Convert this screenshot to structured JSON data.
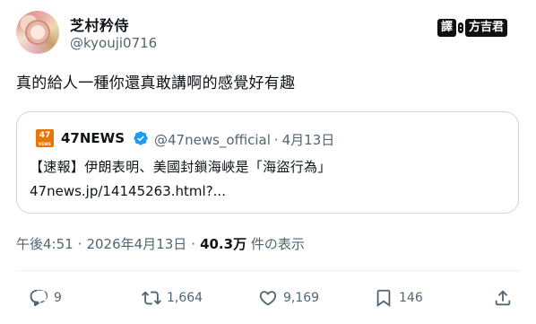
{
  "author": {
    "display_name": "芝村矜侍",
    "handle": "@kyouji0716"
  },
  "watermark": {
    "label": "譯",
    "brand": "方吉君"
  },
  "tweet": {
    "text": "真的給人一種你還真敢講啊的感覺好有趣"
  },
  "quoted_tweet": {
    "logo_text": "47",
    "name": "47NEWS",
    "handle": "@47news_official",
    "date": "4月13日",
    "line1": "【速報】伊朗表明、美國封鎖海峽是「海盜行為」",
    "line2": "47news.jp/14145263.html?..."
  },
  "meta": {
    "time": "午後4:51",
    "date": "2026年4月13日",
    "views_count": "40.3万",
    "views_label": "件の表示"
  },
  "actions": {
    "replies": "9",
    "retweets": "1,664",
    "likes": "9,169",
    "bookmarks": "146"
  },
  "colors": {
    "text": "#0f1419",
    "muted": "#536471",
    "verified": "#1d9bf0",
    "logo": "#e8740c"
  }
}
